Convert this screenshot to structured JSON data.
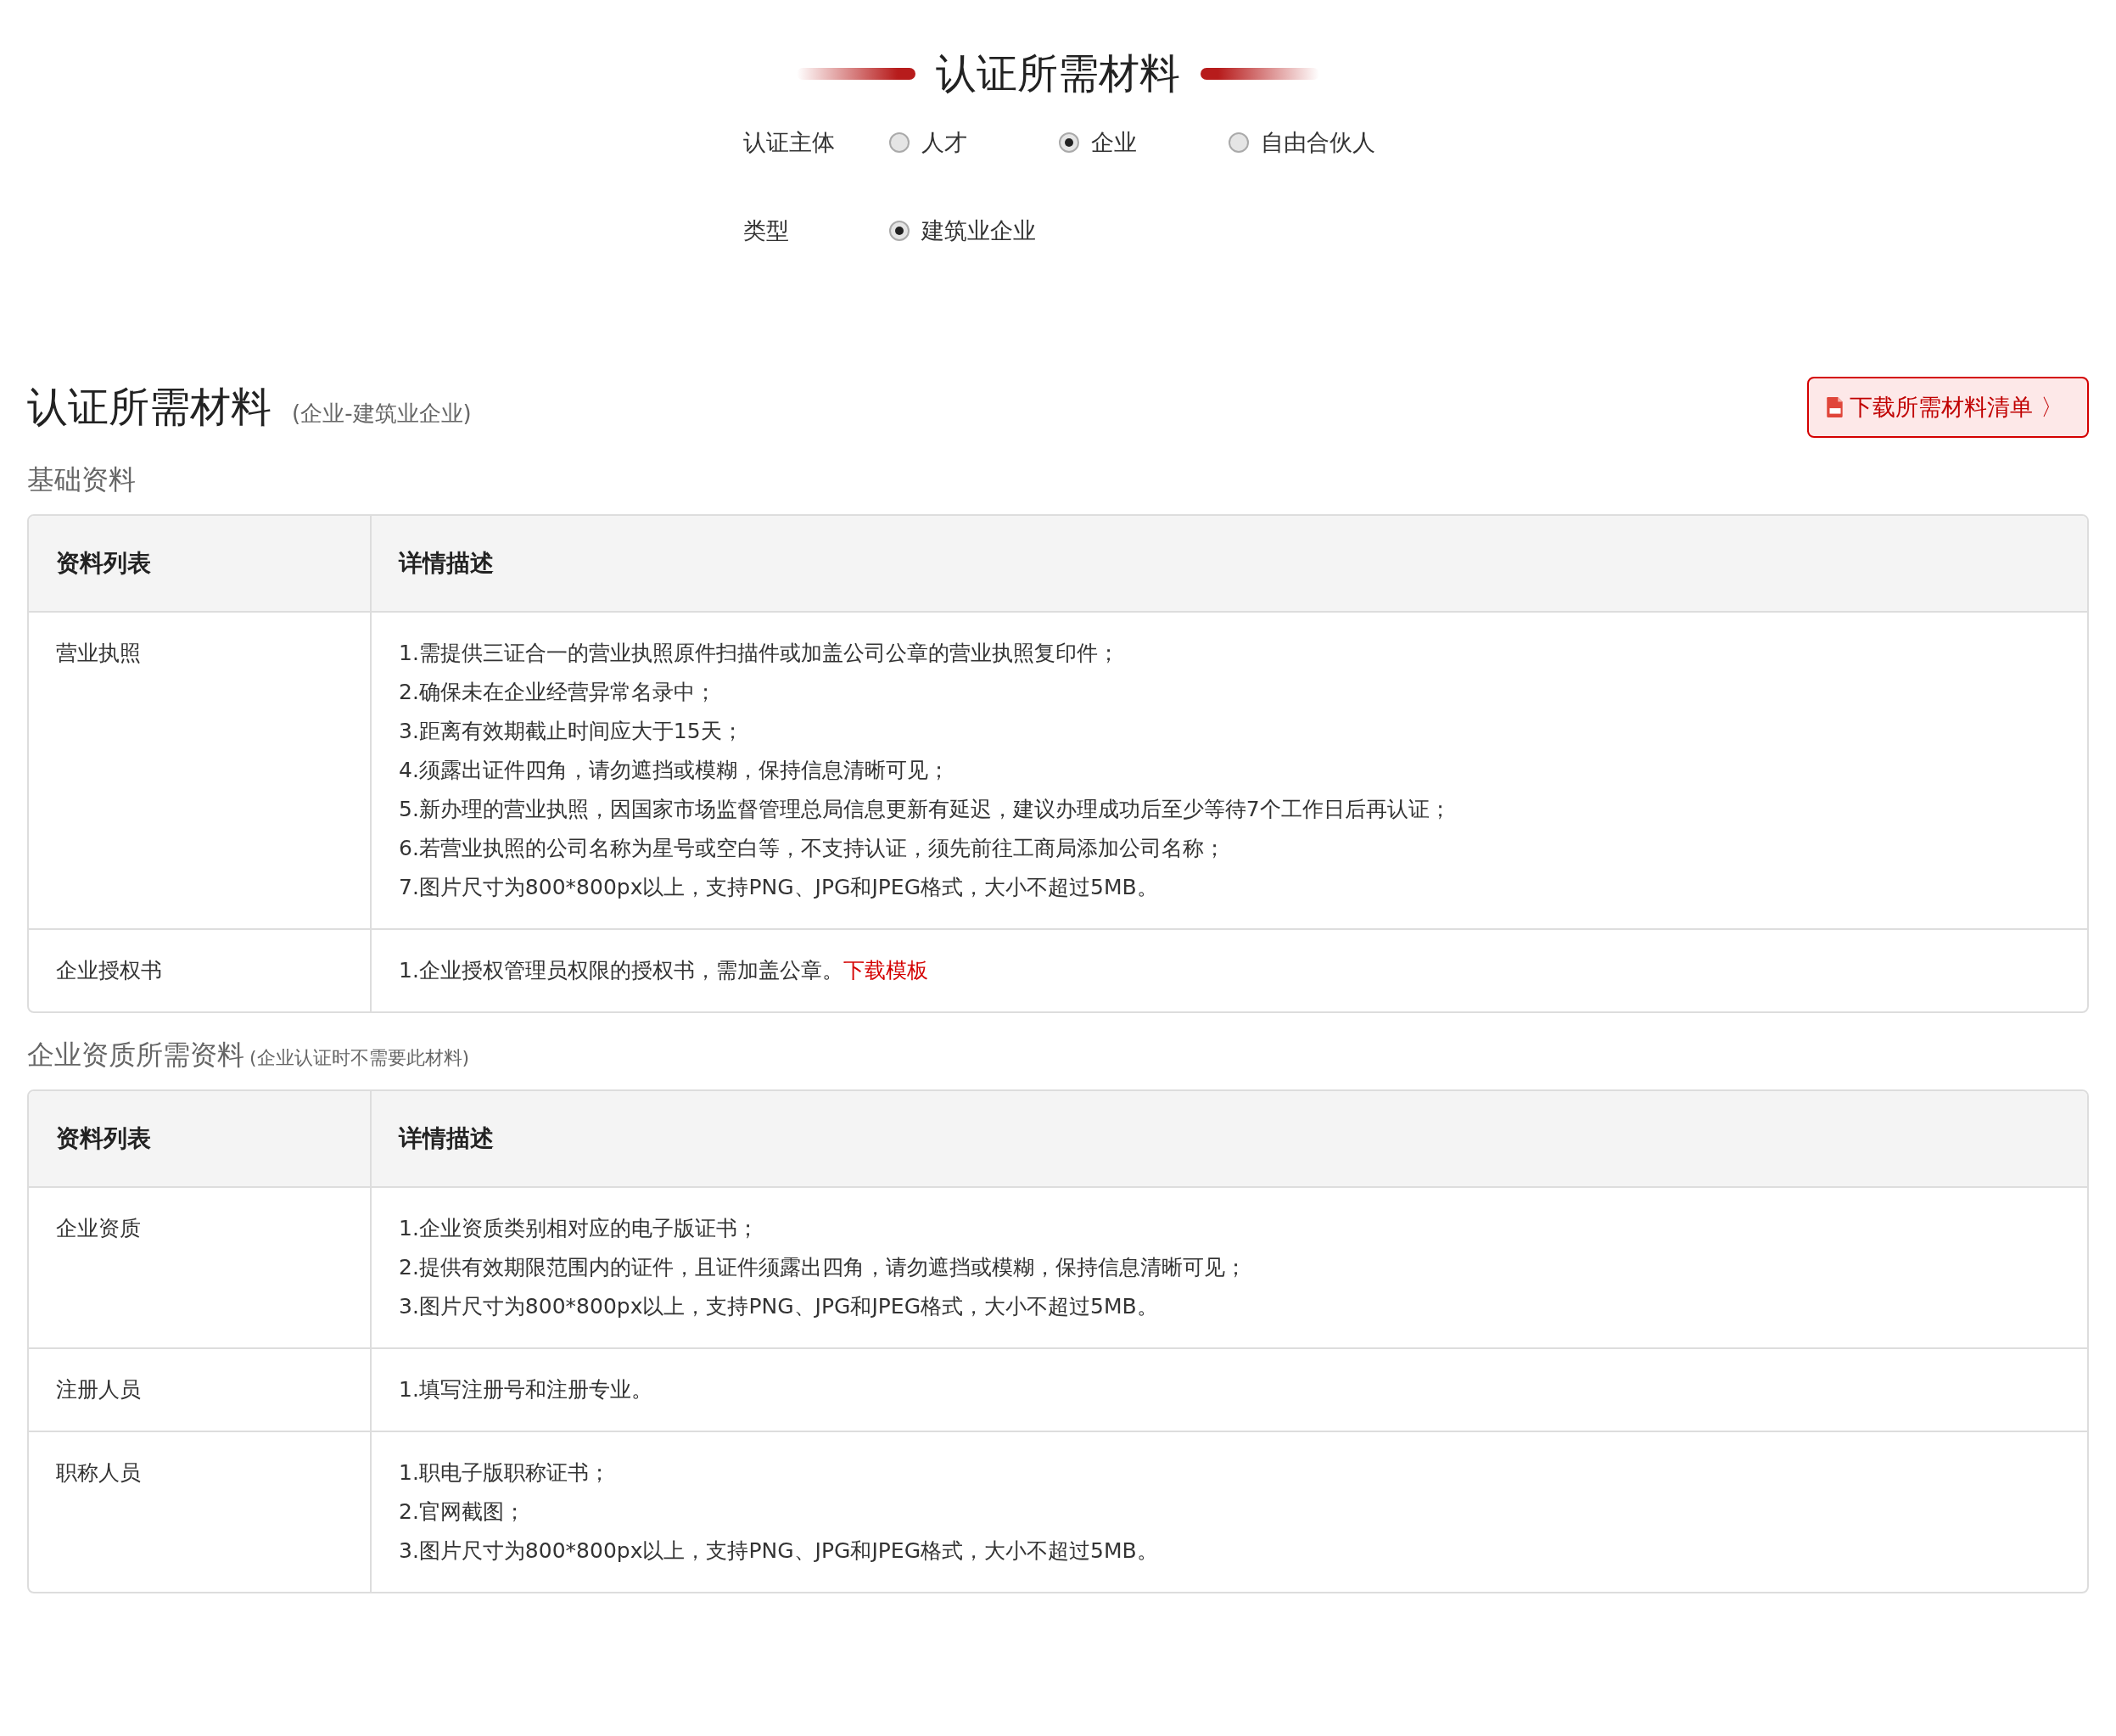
{
  "header": {
    "title": "认证所需材料"
  },
  "filters": [
    {
      "label": "认证主体",
      "options": [
        {
          "label": "人才",
          "selected": false
        },
        {
          "label": "企业",
          "selected": true
        },
        {
          "label": "自由合伙人",
          "selected": false
        }
      ]
    },
    {
      "label": "类型",
      "options": [
        {
          "label": "建筑业企业",
          "selected": true
        }
      ]
    }
  ],
  "section": {
    "title": "认证所需材料",
    "subtitle": "(企业-建筑业企业)",
    "download_button": "下载所需材料清单 〉"
  },
  "groups": [
    {
      "title": "基础资料",
      "columns": [
        "资料列表",
        "详情描述"
      ],
      "rows": [
        {
          "name": "营业执照",
          "lines": [
            "1.需提供三证合一的营业执照原件扫描件或加盖公司公章的营业执照复印件；",
            "2.确保未在企业经营异常名录中；",
            "3.距离有效期截止时间应大于15天；",
            "4.须露出证件四角，请勿遮挡或模糊，保持信息清晰可见；",
            "5.新办理的营业执照，因国家市场监督管理总局信息更新有延迟，建议办理成功后至少等待7个工作日后再认证；",
            "6.若营业执照的公司名称为星号或空白等，不支持认证，须先前往工商局添加公司名称；",
            "7.图片尺寸为800*800px以上，支持PNG、JPG和JPEG格式，大小不超过5MB。"
          ]
        },
        {
          "name": "企业授权书",
          "lines": [
            "1.企业授权管理员权限的授权书，需加盖公章。"
          ],
          "link": "下载模板"
        }
      ]
    },
    {
      "title": "企业资质所需资料",
      "note": "(企业认证时不需要此材料)",
      "columns": [
        "资料列表",
        "详情描述"
      ],
      "rows": [
        {
          "name": "企业资质",
          "lines": [
            "1.企业资质类别相对应的电子版证书；",
            "2.提供有效期限范围内的证件，且证件须露出四角，请勿遮挡或模糊，保持信息清晰可见；",
            "3.图片尺寸为800*800px以上，支持PNG、JPG和JPEG格式，大小不超过5MB。"
          ]
        },
        {
          "name": "注册人员",
          "lines": [
            "1.填写注册号和注册专业。"
          ]
        },
        {
          "name": "职称人员",
          "lines": [
            "1.职电子版职称证书；",
            "2.官网截图；",
            "3.图片尺寸为800*800px以上，支持PNG、JPG和JPEG格式，大小不超过5MB。"
          ]
        }
      ]
    }
  ]
}
